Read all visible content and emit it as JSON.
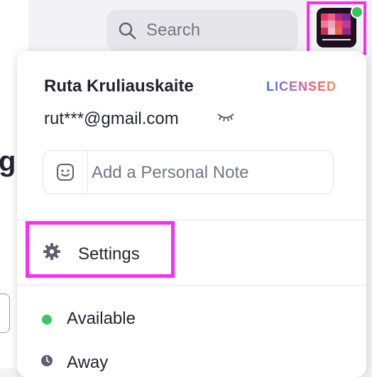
{
  "search": {
    "placeholder": "Search",
    "icon": "search-icon"
  },
  "profile": {
    "name": "Ruta Kruliauskaite",
    "license": "LICENSED",
    "email": "rut***@gmail.com",
    "reveal_icon": "eye-closed-icon",
    "status_color": "#34c759"
  },
  "note": {
    "placeholder": "Add a Personal Note",
    "icon": "smiley-icon"
  },
  "menu": {
    "settings": {
      "label": "Settings",
      "icon": "gear-icon"
    },
    "statuses": [
      {
        "label": "Available",
        "color": "#3fc463"
      },
      {
        "label": "Away",
        "icon": "clock-icon"
      }
    ]
  },
  "highlight_color": "#ff2bf5"
}
